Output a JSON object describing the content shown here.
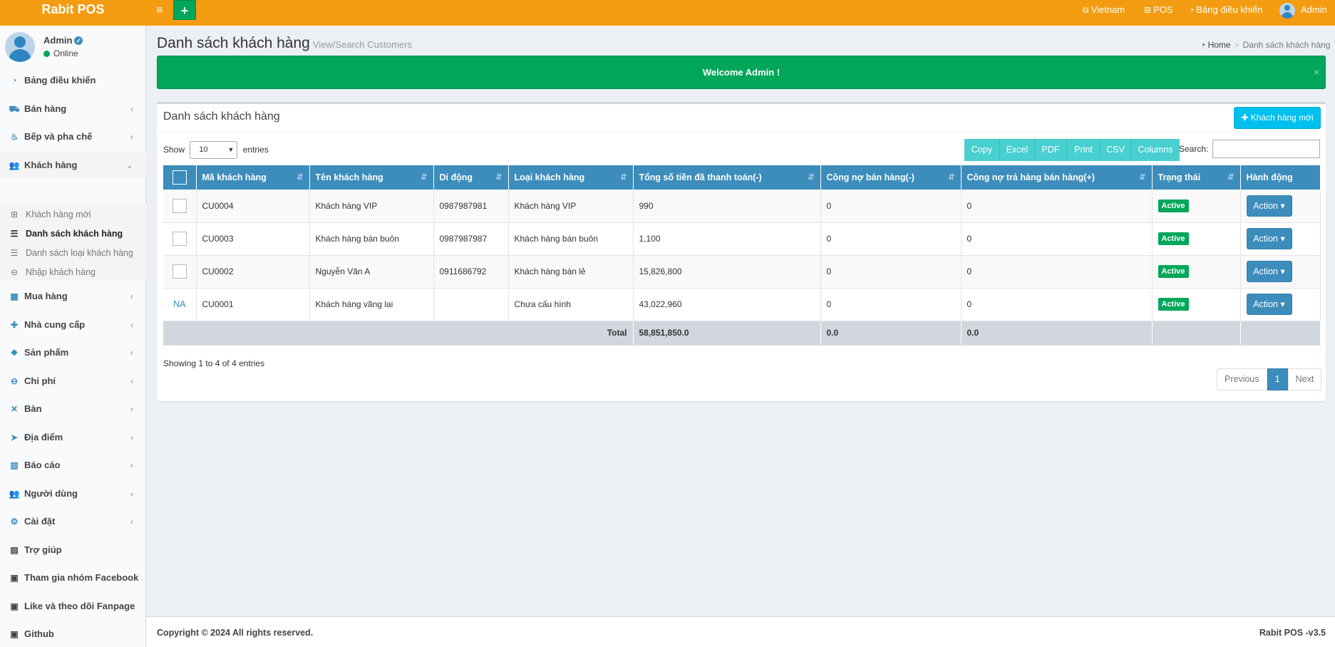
{
  "app": {
    "logo": "Rabit POS"
  },
  "topnav": {
    "add_label": "+",
    "menu_label": "≡",
    "language": "Vietnam",
    "pos": "POS",
    "dashboard": "Bảng điều khiển",
    "user": "Admin"
  },
  "sidebar": {
    "user": {
      "name": "Admin",
      "status": "Online"
    },
    "items": [
      {
        "label": "Bảng điều khiển",
        "icon": "dashboard-icon"
      },
      {
        "label": "Bán hàng",
        "icon": "cart-icon"
      },
      {
        "label": "Bếp và pha chế",
        "icon": "kitchen-icon"
      },
      {
        "label": "Khách hàng",
        "icon": "users-icon"
      },
      {
        "label": "Mua hàng",
        "icon": "grid-icon"
      },
      {
        "label": "Nhà cung cấp",
        "icon": "user-plus-icon"
      },
      {
        "label": "Sản phẩm",
        "icon": "cubes-icon"
      },
      {
        "label": "Chi phí",
        "icon": "minus-circle-icon"
      },
      {
        "label": "Bàn",
        "icon": "cutlery-icon"
      },
      {
        "label": "Địa điểm",
        "icon": "paper-plane-icon"
      },
      {
        "label": "Báo cáo",
        "icon": "bar-chart-icon"
      },
      {
        "label": "Người dùng",
        "icon": "users-icon"
      },
      {
        "label": "Cài đặt",
        "icon": "cogs-icon"
      },
      {
        "label": "Trợ giúp",
        "icon": "book-icon"
      },
      {
        "label": "Tham gia nhóm Facebook",
        "icon": "briefcase-icon"
      },
      {
        "label": "Like và theo dõi Fanpage",
        "icon": "briefcase-icon"
      },
      {
        "label": "Github",
        "icon": "briefcase-icon"
      }
    ],
    "submenu": [
      {
        "label": "Khách hàng mới"
      },
      {
        "label": "Danh sách khách hàng"
      },
      {
        "label": "Danh sách loại khách hàng"
      },
      {
        "label": "Nhập khách hàng"
      }
    ]
  },
  "page": {
    "title": "Danh sách khách hàng",
    "subtitle": "View/Search Customers",
    "breadcrumb": {
      "home": "Home",
      "current": "Danh sách khách hàng"
    }
  },
  "alert": {
    "text": "Welcome Admin !",
    "close": "×"
  },
  "box": {
    "title": "Danh sách khách hàng",
    "new_button": "Khách hàng mới",
    "show": "Show",
    "length_value": "10",
    "entries": "entries",
    "search_label": "Search:",
    "search_value": "",
    "export_buttons": [
      "Copy",
      "Excel",
      "PDF",
      "Print",
      "CSV",
      "Columns"
    ]
  },
  "table": {
    "columns": [
      "Mã khách hàng",
      "Tên khách hàng",
      "Di động",
      "Loại khách hàng",
      "Tổng số tiền đã thanh toán(-)",
      "Công nợ bán hàng(-)",
      "Công nợ trả hàng bán hàng(+)",
      "Trạng thái",
      "Hành động"
    ],
    "rows": [
      {
        "select": "",
        "code": "CU0004",
        "name": "Khách hàng VIP",
        "phone": "0987987981",
        "type": "Khách hàng VIP",
        "paid": "990",
        "debt": "0",
        "return_debt": "0",
        "status": "Active",
        "action": "Action"
      },
      {
        "select": "",
        "code": "CU0003",
        "name": "Khách hàng bán buôn",
        "phone": "0987987987",
        "type": "Khách hàng bán buôn",
        "paid": "1,100",
        "debt": "0",
        "return_debt": "0",
        "status": "Active",
        "action": "Action"
      },
      {
        "select": "",
        "code": "CU0002",
        "name": "Nguyễn Văn A",
        "phone": "0911686792",
        "type": "Khách hàng bán lẻ",
        "paid": "15,826,800",
        "debt": "0",
        "return_debt": "0",
        "status": "Active",
        "action": "Action"
      },
      {
        "select": "NA",
        "code": "CU0001",
        "name": "Khách hàng vãng lai",
        "phone": "",
        "type": "Chưa cấu hình",
        "paid": "43,022,960",
        "debt": "0",
        "return_debt": "0",
        "status": "Active",
        "action": "Action"
      }
    ],
    "footer": {
      "label": "Total",
      "paid": "58,851,850.0",
      "debt": "0.0",
      "return_debt": "0.0"
    }
  },
  "info": "Showing 1 to 4 of 4 entries",
  "pagination": {
    "previous": "Previous",
    "page": "1",
    "next": "Next"
  },
  "footer": {
    "copyright": "Copyright © 2024 All rights reserved.",
    "version": "Rabit POS -v3.5"
  }
}
